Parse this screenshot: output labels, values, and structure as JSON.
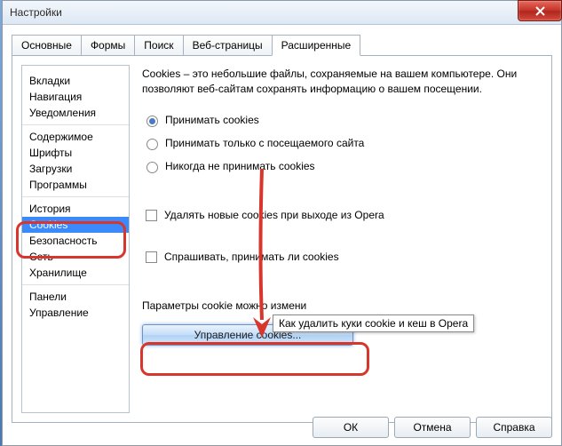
{
  "window": {
    "title": "Настройки"
  },
  "tabs": [
    "Основные",
    "Формы",
    "Поиск",
    "Веб-страницы",
    "Расширенные"
  ],
  "active_tab": 4,
  "sidebar": {
    "groups": [
      {
        "items": [
          "Вкладки",
          "Навигация",
          "Уведомления"
        ]
      },
      {
        "items": [
          "Содержимое",
          "Шрифты",
          "Загрузки",
          "Программы"
        ]
      },
      {
        "items": [
          "История",
          "Cookies",
          "Безопасность",
          "Сеть",
          "Хранилище"
        ]
      },
      {
        "items": [
          "Панели",
          "Управление"
        ]
      }
    ],
    "selected": "Cookies"
  },
  "main": {
    "description": "Cookies – это небольшие файлы, сохраняемые на вашем компьютере. Они позволяют веб-сайтам сохранять информацию о вашем посещении.",
    "radios": [
      {
        "label": "Принимать cookies",
        "checked": true
      },
      {
        "label": "Принимать только с посещаемого сайта",
        "checked": false
      },
      {
        "label": "Никогда не принимать cookies",
        "checked": false
      }
    ],
    "checks": [
      {
        "label": "Удалять новые cookies при выходе из Opera",
        "checked": false
      },
      {
        "label": "Спрашивать, принимать ли cookies",
        "checked": false
      }
    ],
    "param_text": "Параметры cookie можно измени",
    "manage_btn": "Управление cookies...",
    "tooltip": "Как удалить куки cookie и кеш в Opera"
  },
  "buttons": {
    "ok": "ОК",
    "cancel": "Отмена",
    "help": "Справка"
  }
}
